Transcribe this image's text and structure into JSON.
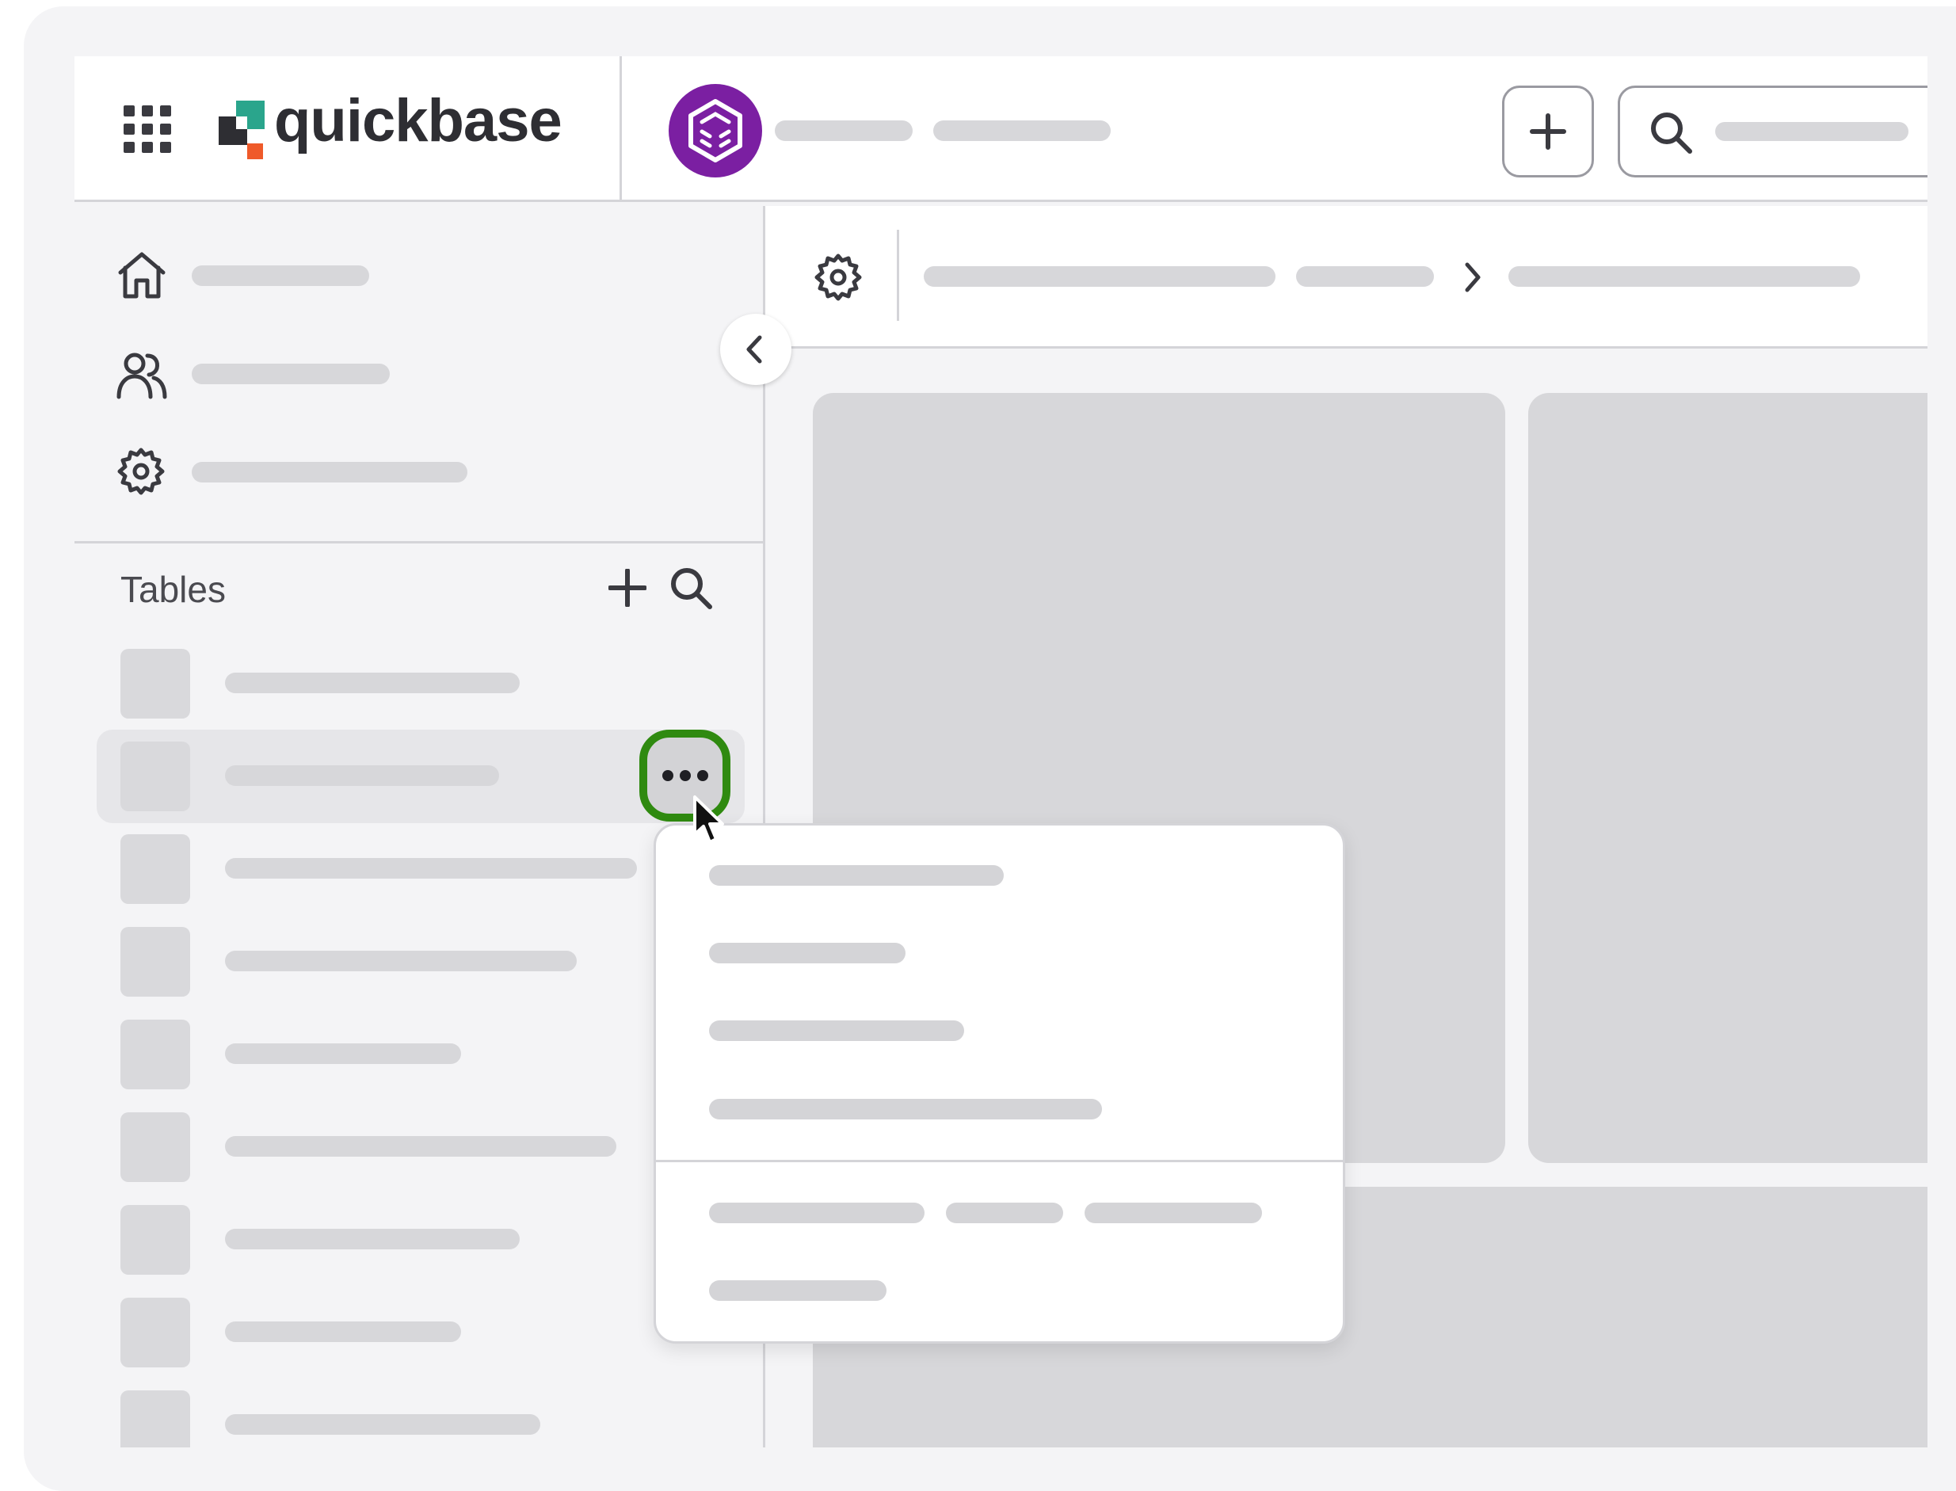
{
  "header": {
    "brand": "quickbase",
    "apps_grid_icon": "apps-grid-icon",
    "app_icon": "cube-app-icon",
    "add_icon": "plus-icon",
    "search_icon": "search-icon",
    "app_icon_color": "#7b1fa2"
  },
  "sidebar": {
    "nav_icons": [
      "home-icon",
      "users-icon",
      "gear-icon"
    ],
    "tables_label": "Tables",
    "tables_add_icon": "plus-icon",
    "tables_search_icon": "search-icon",
    "table_rows": 9,
    "highlight_color": "#2f8a10"
  },
  "main": {
    "settings_icon": "gear-icon",
    "breadcrumb_separator_icon": "chevron-right-icon",
    "collapse_icon": "chevron-left-icon"
  },
  "context_menu": {
    "more_icon": "ellipsis-icon"
  }
}
